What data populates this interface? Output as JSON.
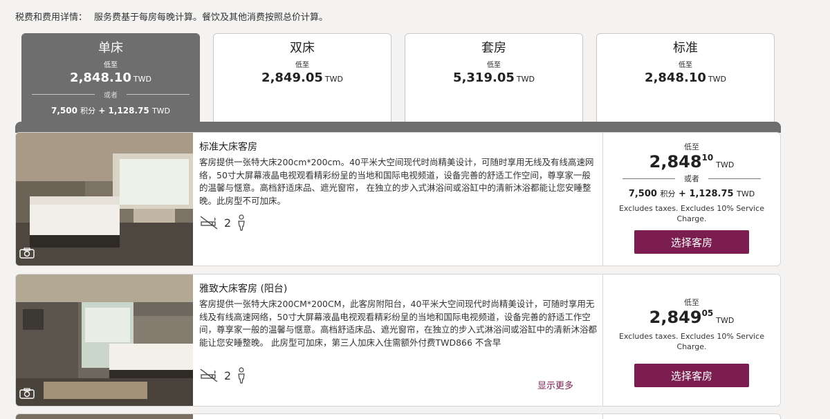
{
  "tax": {
    "label": "税费和费用详情：",
    "text": "服务费基于每房每晚计算。餐饮及其他消费按照总价计算。"
  },
  "tabs": [
    {
      "name": "单床",
      "low": "低至",
      "price": "2,848.10",
      "currency": "TWD",
      "or": "或者",
      "points": "7,500",
      "points_unit": "积分",
      "plus": "+ 1,128.75",
      "plus_currency": "TWD"
    },
    {
      "name": "双床",
      "low": "低至",
      "price": "2,849.05",
      "currency": "TWD"
    },
    {
      "name": "套房",
      "low": "低至",
      "price": "5,319.05",
      "currency": "TWD"
    },
    {
      "name": "标准",
      "low": "低至",
      "price": "2,848.10",
      "currency": "TWD"
    }
  ],
  "rooms": [
    {
      "title": "标准大床客房",
      "desc": "客房提供一张特大床200cm*200cm。40平米大空间现代时尚精美设计，可随时享用无线及有线高速网络，50寸大屏幕液晶电视观看精彩纷呈的当地和国际电视频道，设备完善的舒适工作空间，尊享家一般的温馨与惬意。高档舒适床品、遮光窗帘， 在独立的步入式淋浴间或浴缸中的清新沐浴都能让您安睡整晚。此房型不可加床。",
      "guests": "2",
      "low": "低至",
      "price_main": "2,848",
      "price_dec": "10",
      "currency": "TWD",
      "or": "或者",
      "points": "7,500",
      "points_unit": "积分",
      "plus": "+ 1,128.75",
      "plus_currency": "TWD",
      "note": "Excludes taxes. Excludes 10% Service Charge.",
      "button": "选择客房"
    },
    {
      "title": "雅致大床客房 (阳台)",
      "desc": "客房提供一张特大床200CM*200CM，此客房附阳台，40平米大空间现代时尚精美设计，可随时享用无线及有线高速网络，50寸大屏幕液晶电视观看精彩纷呈的当地和国际电视频道，设备完善的舒适工作空间，尊享家一般的温馨与惬意。高档舒适床品、遮光窗帘，在独立的步入式淋浴间或浴缸中的清新沐浴都能让您安睡整晚。 此房型可加床，第三人加床入住需额外付费TWD866 不含早",
      "guests": "2",
      "more": "显示更多",
      "low": "低至",
      "price_main": "2,849",
      "price_dec": "05",
      "currency": "TWD",
      "note": "Excludes taxes. Excludes 10% Service Charge.",
      "button": "选择客房"
    }
  ],
  "colors": {
    "accent": "#7b1e4f",
    "active_tab": "#6e6e6e"
  },
  "icons": [
    "no-smoking-icon",
    "person-icon",
    "camera-icon"
  ]
}
